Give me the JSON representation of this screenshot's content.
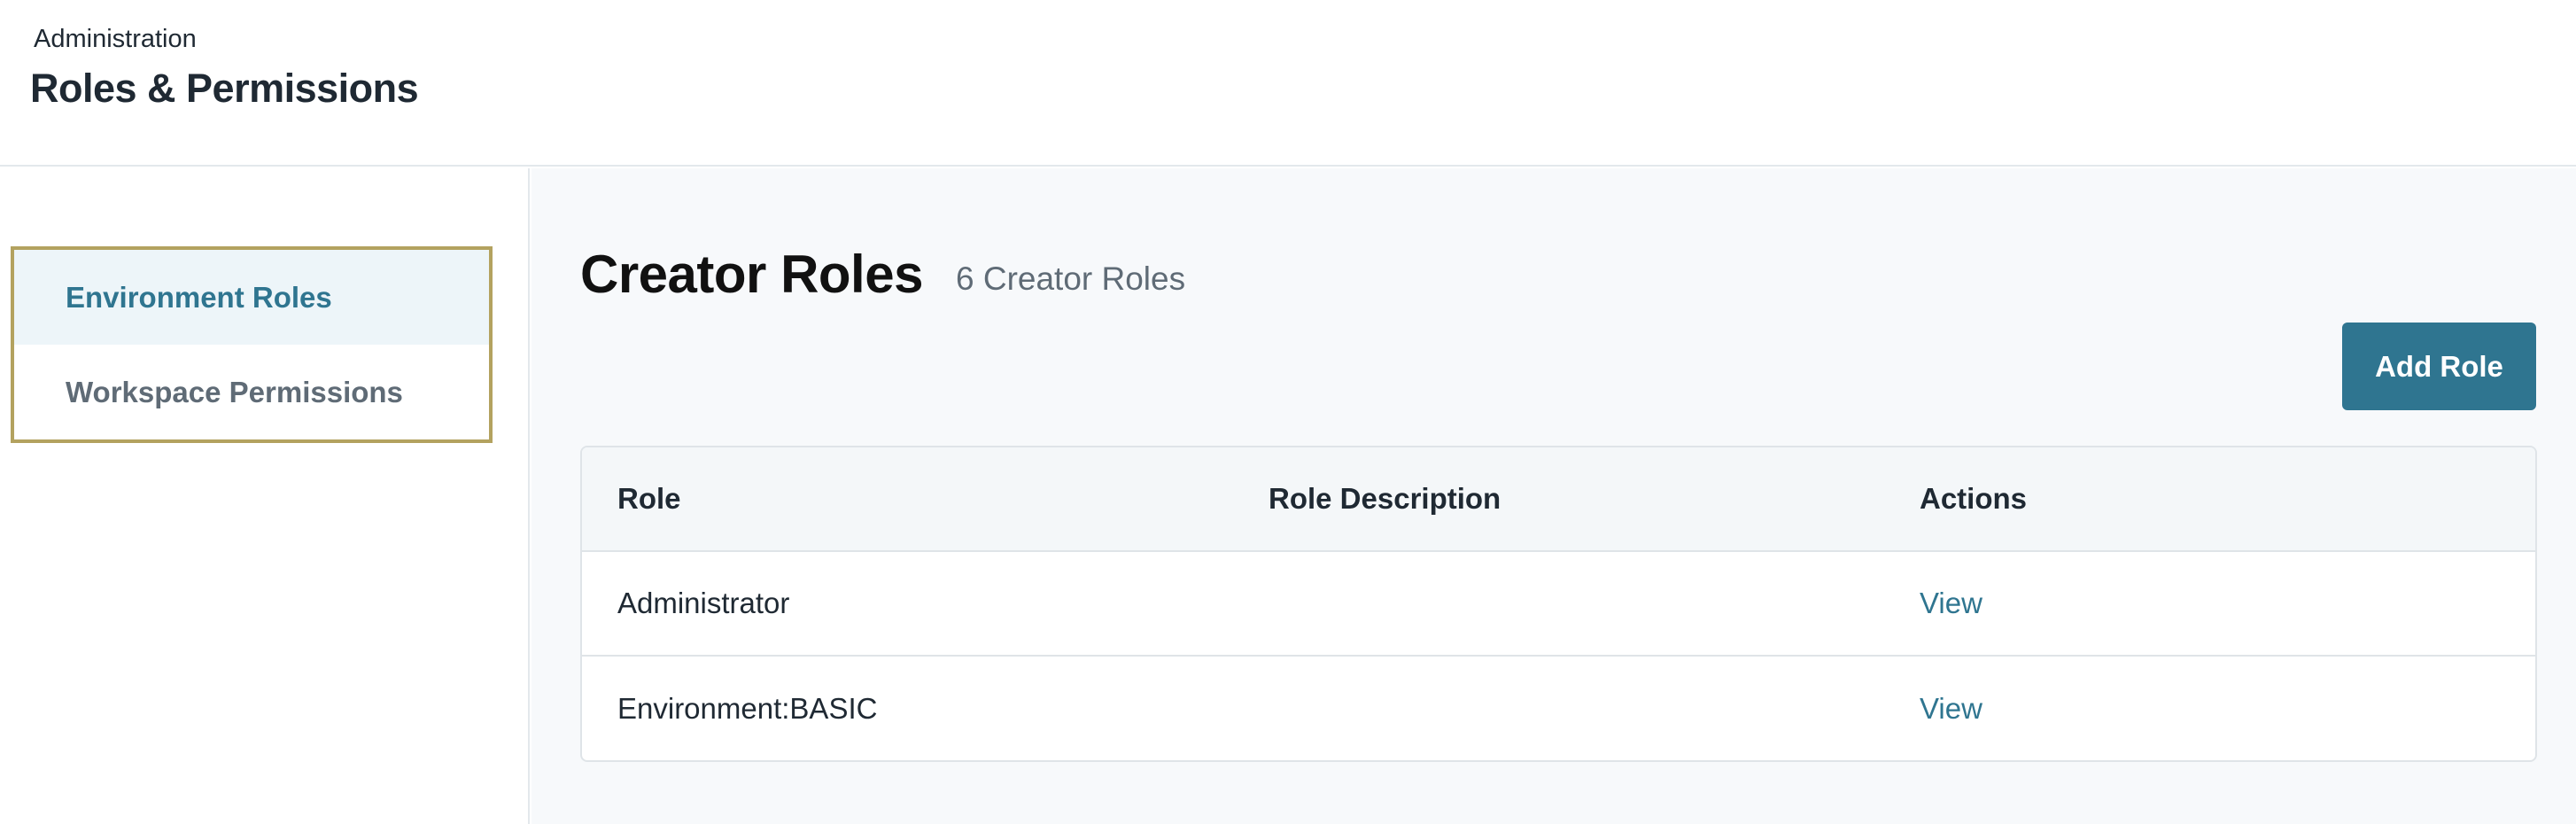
{
  "header": {
    "breadcrumb": "Administration",
    "title": "Roles & Permissions"
  },
  "sidebar": {
    "items": [
      {
        "label": "Environment Roles",
        "active": true
      },
      {
        "label": "Workspace Permissions",
        "active": false
      }
    ]
  },
  "main": {
    "title": "Creator Roles",
    "count": "6 Creator Roles",
    "add_button": "Add Role",
    "table": {
      "columns": [
        "Role",
        "Role Description",
        "Actions"
      ],
      "rows": [
        {
          "role": "Administrator",
          "description": "",
          "action": "View"
        },
        {
          "role": "Environment:BASIC",
          "description": "",
          "action": "View"
        }
      ]
    }
  },
  "colors": {
    "accent": "#2f7590",
    "sidebar_border": "#b3a25f",
    "active_bg": "#edf5f9"
  }
}
